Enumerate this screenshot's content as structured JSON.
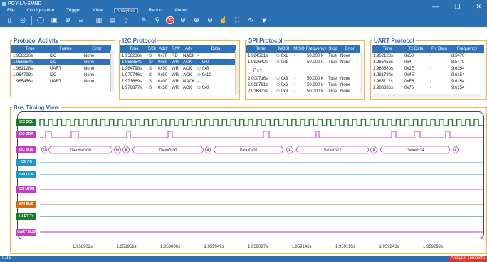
{
  "window": {
    "title": "PGY-LA-EMBD",
    "minimize": "—",
    "maximize": "❐",
    "close": "✕"
  },
  "menu": [
    "File",
    "Configuration",
    "Trigger",
    "View",
    "Analytics",
    "Report",
    "About"
  ],
  "menu_active": "Analytics",
  "toolbar_icons": [
    "new-icon",
    "signal-icon",
    "run-icon",
    "capture-icon",
    "settings-icon",
    "math-icon",
    "bar-icon",
    "layout-icon",
    "info-icon",
    "edit-icon",
    "probe-icon",
    "stop-icon",
    "trigger-icon",
    "zoom-in-icon",
    "zoom-out-icon",
    "cursor-icon",
    "fit-icon",
    "wave-icon",
    "filter-icon"
  ],
  "protocol_activity": {
    "title": "Protocol Activity",
    "headers": [
      "Time",
      "Frame",
      "Error"
    ],
    "rows": [
      [
        "1.958236s",
        "I2C",
        "None"
      ],
      [
        "1.958854s",
        "I2C",
        "None"
      ],
      [
        "1.962128s",
        "UART",
        "None"
      ],
      [
        "1.964798s",
        "I2C",
        "None"
      ],
      [
        "1.965456s",
        "UART",
        "None"
      ]
    ],
    "selected": 1
  },
  "i2c_protocol": {
    "title": "I2C Protocol",
    "headers": [
      "Time",
      "S/Sr",
      "Addr",
      "R/W",
      "A/N",
      "Data"
    ],
    "rows": [
      [
        "1.958236s",
        "S",
        "0x7F",
        "RD",
        "NACK",
        "-"
      ],
      [
        "1.958854s",
        "Sr",
        "0x50",
        "WR",
        "ACK",
        "0x0"
      ],
      [
        "1.964798s",
        "S",
        "0x50",
        "WR",
        "ACK",
        "0x8"
      ],
      [
        "1.970746s",
        "S",
        "0x50",
        "WR",
        "ACK",
        "0x10"
      ],
      [
        "1.971669s",
        "S",
        "0x00",
        "WR",
        "NACK",
        "-"
      ],
      [
        "1.976877s",
        "S",
        "0x50",
        "WR",
        "ACK",
        "0x0"
      ]
    ],
    "selected": 1
  },
  "spi_protocol": {
    "title": "SPI Protocol",
    "headers": [
      "Time",
      "MOSI",
      "MISO",
      "Frequency",
      "Stop",
      "Error"
    ],
    "rows": [
      [
        "1.984561s",
        "0x1",
        "-",
        "50.000 k",
        "True",
        "None"
      ],
      [
        "1.992642s",
        "0x1",
        "-",
        "50.000 k",
        "True",
        "None"
      ],
      [
        "",
        "0x1",
        "",
        "",
        "",
        ""
      ],
      [
        "2.000716s",
        "0x3",
        "-",
        "50.000 k",
        "True",
        "None"
      ],
      [
        "2.008791s",
        "0x6",
        "-",
        "50.000 k",
        "True",
        "None"
      ],
      [
        "2.016873s",
        "0x3",
        "-",
        "50.000 k",
        "True",
        "None"
      ]
    ]
  },
  "uart_protocol": {
    "title": "UART Protocol",
    "headers": [
      "Time",
      "Tx Data",
      "Rx Data",
      "Frequency"
    ],
    "rows": [
      [
        "1.962128s",
        "0x50",
        "-",
        "8.5470"
      ],
      [
        "1.965456s",
        "0x4",
        "-",
        "8.5470"
      ],
      [
        "1.968680s",
        "0x2E",
        "-",
        "9.6154"
      ],
      [
        "1.981784s",
        "0x4E",
        "-",
        "9.6154"
      ],
      [
        "1.985112s",
        "0xF6",
        "-",
        "9.6154"
      ],
      [
        "1.988336s",
        "0x76",
        "-",
        "9.6154"
      ]
    ]
  },
  "bus_timing": {
    "title": "Bus Timing View",
    "channels": [
      {
        "name": "I2C SCL",
        "color": "#1d7a2c"
      },
      {
        "name": "I2C SDA",
        "color": "#c23fc0"
      },
      {
        "name": "I2C BUS",
        "color": "#c23fc0"
      },
      {
        "name": "SPI CS",
        "color": "#2196c9"
      },
      {
        "name": "SPI CLK",
        "color": "#2196c9"
      },
      {
        "name": "SPI MOSI",
        "color": "#c23fc0"
      },
      {
        "name": "SPI BUS",
        "color": "#d56a16"
      },
      {
        "name": "UART Tx",
        "color": "#1d7a2c"
      },
      {
        "name": "UART BUS",
        "color": "#c23fc0"
      }
    ],
    "bus_segments": [
      "Sr",
      "7bAddr=0x50",
      "W",
      "A",
      "Data=0x00",
      "A",
      "Data=0x10",
      "A",
      "Data=0x12",
      "A",
      "Data=0x14",
      "A"
    ],
    "timestamps": [
      "1.958902s",
      "1.958951s",
      "1.959000s",
      "1.959049s",
      "1.959097s",
      "1.959146s",
      "1.959195s",
      "1.959243s",
      "1.959292s"
    ]
  },
  "status": {
    "left": "0.8.8",
    "right": "Analysis complete"
  }
}
